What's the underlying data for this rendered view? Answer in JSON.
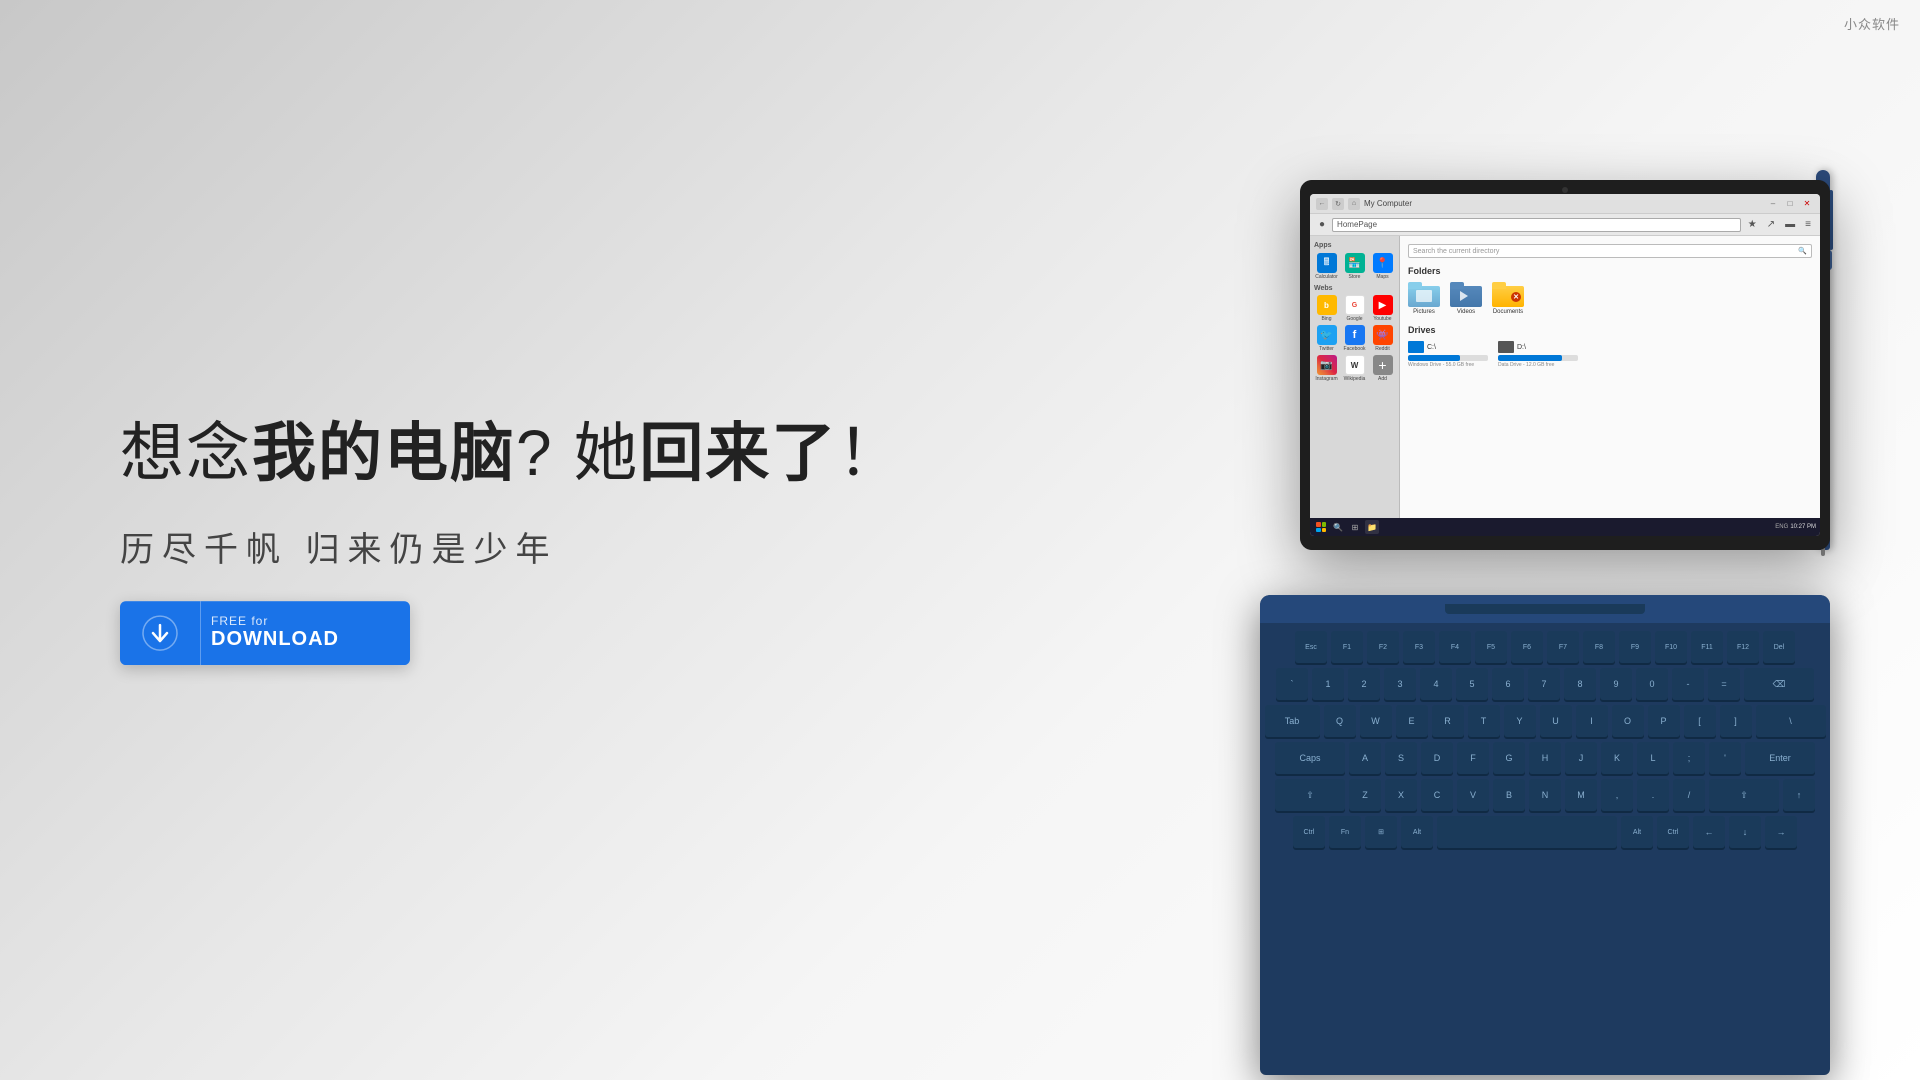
{
  "watermark": {
    "text": "小众软件"
  },
  "page": {
    "headline_part1": "想念",
    "headline_bold1": "我的电脑",
    "headline_part2": "? 她",
    "headline_bold2": "回来了",
    "headline_part3": "！",
    "subheadline": "历尽千帆    归来仍是少年",
    "download_button": {
      "free_text": "FREE for",
      "main_text": "DOWNLOAD"
    }
  },
  "windows_ui": {
    "title": "My Computer",
    "address": "HomePage",
    "search_placeholder": "Search the current directory",
    "folders_title": "Folders",
    "folders": [
      {
        "name": "Pictures"
      },
      {
        "name": "Videos"
      },
      {
        "name": "Documents"
      }
    ],
    "drives_title": "Drives",
    "drives": [
      {
        "label": "C:\\",
        "fill_pct": 65,
        "info": "Windows Drive - 55.0 GB free"
      },
      {
        "label": "D:\\",
        "fill_pct": 80,
        "info": "Data Drive - 12.0 GB free"
      }
    ],
    "apps_title": "Apps",
    "apps": [
      {
        "name": "Calculator",
        "color": "#0078d7"
      },
      {
        "name": "Store",
        "color": "#00b294"
      },
      {
        "name": "Maps",
        "color": "#007bff"
      }
    ],
    "webs_title": "Webs",
    "webs": [
      {
        "name": "Bing"
      },
      {
        "name": "Google"
      },
      {
        "name": "Youtube"
      },
      {
        "name": "Twitter"
      },
      {
        "name": "Facebook"
      },
      {
        "name": "Reddit"
      },
      {
        "name": "Instagram"
      },
      {
        "name": "Wikipedia"
      },
      {
        "name": "Add"
      }
    ],
    "taskbar_time": "10:27 PM"
  },
  "colors": {
    "download_btn": "#1a73e8",
    "surface_dark": "#1e3a5f",
    "keyboard_bg": "#1e3a5f"
  }
}
